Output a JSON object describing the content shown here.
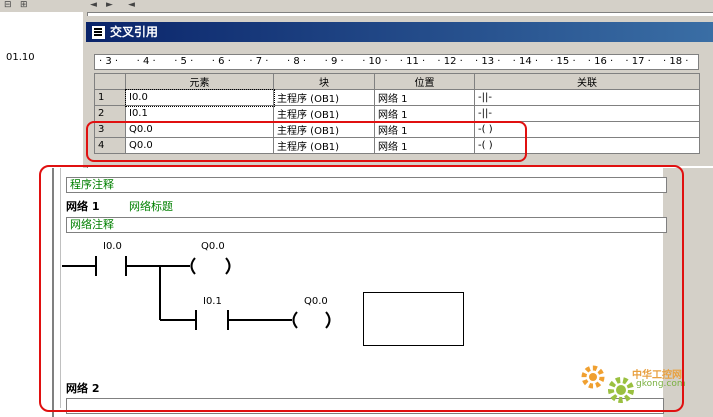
{
  "window": {
    "title": "交叉引用"
  },
  "left_panel": {
    "version_text": "01.10"
  },
  "ruler": {
    "ticks": [
      "3",
      "4",
      "5",
      "6",
      "7",
      "8",
      "9",
      "10",
      "11",
      "12",
      "13",
      "14",
      "15",
      "16",
      "17",
      "18"
    ]
  },
  "table": {
    "headers": [
      "元素",
      "块",
      "位置",
      "关联"
    ],
    "rows": [
      {
        "num": "1",
        "element": "I0.0",
        "block": "主程序 (OB1)",
        "location": "网络 1",
        "relation": "-||-"
      },
      {
        "num": "2",
        "element": "I0.1",
        "block": "主程序 (OB1)",
        "location": "网络 1",
        "relation": "-||-"
      },
      {
        "num": "3",
        "element": "Q0.0",
        "block": "主程序 (OB1)",
        "location": "网络 1",
        "relation": "-( )"
      },
      {
        "num": "4",
        "element": "Q0.0",
        "block": "主程序 (OB1)",
        "location": "网络 1",
        "relation": "-( )"
      }
    ]
  },
  "editor": {
    "program_comment": "程序注释",
    "network1_label": "网络 1",
    "network1_title": "网络标题",
    "network_comment": "网络注释",
    "network2_label": "网络 2",
    "ladder": {
      "contact1": "I0.0",
      "coil1": "Q0.0",
      "contact2": "I0.1",
      "coil2": "Q0.0"
    }
  },
  "watermark": {
    "text": "中华工控网",
    "sub": "gkong.com"
  },
  "colors": {
    "annotation": "#e01010",
    "comment_text": "#008000",
    "title_bar": "#0a246a"
  }
}
